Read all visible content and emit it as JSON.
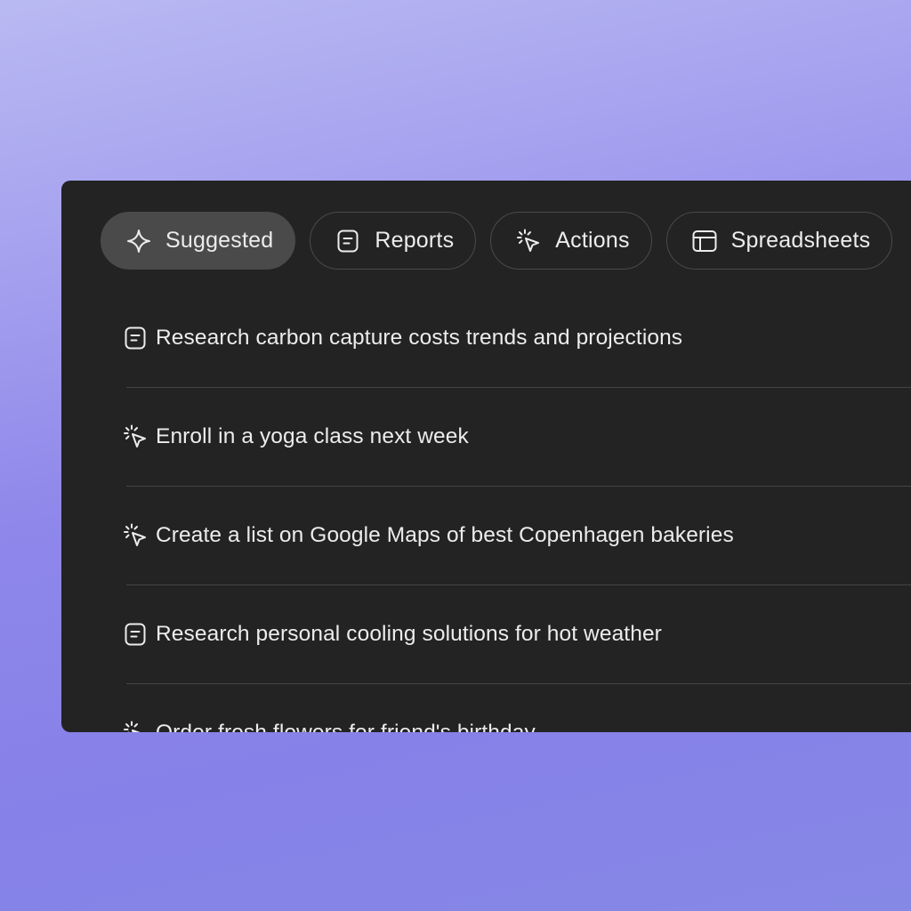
{
  "tabs": [
    {
      "label": "Suggested",
      "icon": "sparkle-icon",
      "active": true
    },
    {
      "label": "Reports",
      "icon": "document-icon",
      "active": false
    },
    {
      "label": "Actions",
      "icon": "cursor-click-icon",
      "active": false
    },
    {
      "label": "Spreadsheets",
      "icon": "table-icon",
      "active": false
    }
  ],
  "suggestions": [
    {
      "text": "Research carbon capture costs trends and projections",
      "icon": "document-icon"
    },
    {
      "text": "Enroll in a yoga class next week",
      "icon": "cursor-click-icon"
    },
    {
      "text": "Create a list on Google Maps of best Copenhagen bakeries",
      "icon": "cursor-click-icon"
    },
    {
      "text": "Research personal cooling solutions for hot weather",
      "icon": "document-icon"
    },
    {
      "text": "Order fresh flowers for friend's birthday",
      "icon": "cursor-click-icon"
    }
  ],
  "colors": {
    "panel_background": "#232323",
    "active_tab_background": "#4a4a4a",
    "text": "#ececec",
    "divider": "#444444"
  }
}
